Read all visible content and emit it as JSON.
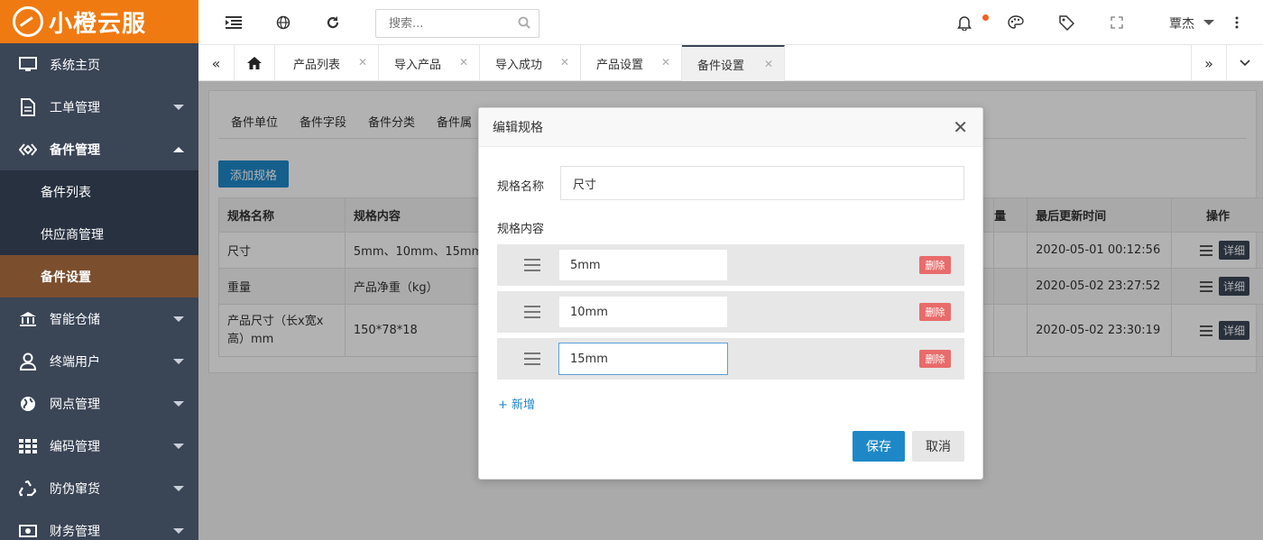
{
  "logo": {
    "text": "小橙云服"
  },
  "sidebar": {
    "items": [
      {
        "label": "系统主页",
        "icon": "monitor-icon"
      },
      {
        "label": "工单管理",
        "icon": "document-icon"
      },
      {
        "label": "备件管理",
        "icon": "diamond-icon"
      },
      {
        "label": "智能仓储",
        "icon": "bank-icon"
      },
      {
        "label": "终端用户",
        "icon": "user-icon"
      },
      {
        "label": "网点管理",
        "icon": "globe-icon"
      },
      {
        "label": "编码管理",
        "icon": "grid-icon"
      },
      {
        "label": "防伪窜货",
        "icon": "recycle-icon"
      },
      {
        "label": "财务管理",
        "icon": "money-icon"
      }
    ],
    "subitems": [
      {
        "label": "备件列表"
      },
      {
        "label": "供应商管理"
      },
      {
        "label": "备件设置"
      }
    ]
  },
  "topbar": {
    "search_placeholder": "搜索...",
    "user_name": "覃杰"
  },
  "tabs": [
    {
      "label": "产品列表"
    },
    {
      "label": "导入产品"
    },
    {
      "label": "导入成功"
    },
    {
      "label": "产品设置"
    },
    {
      "label": "备件设置"
    }
  ],
  "main": {
    "sub_tabs": [
      "备件单位",
      "备件字段",
      "备件分类",
      "备件属"
    ],
    "add_button": "添加规格",
    "table": {
      "headers": [
        "规格名称",
        "规格内容",
        "量",
        "最后更新时间",
        "操作"
      ],
      "rows": [
        {
          "name": "尺寸",
          "content": "5mm、10mm、15mm",
          "updated": "2020-05-01 00:12:56",
          "action": "详细"
        },
        {
          "name": "重量",
          "content": "产品净重（kg）",
          "updated": "2020-05-02 23:27:52",
          "action": "详细"
        },
        {
          "name": "产品尺寸（长x宽x高）mm",
          "content": "150*78*18",
          "updated": "2020-05-02 23:30:19",
          "action": "详细"
        }
      ]
    }
  },
  "modal": {
    "title": "编辑规格",
    "name_label": "规格名称",
    "name_value": "尺寸",
    "content_label": "规格内容",
    "specs": [
      {
        "value": "5mm",
        "delete": "删除"
      },
      {
        "value": "10mm",
        "delete": "删除"
      },
      {
        "value": "15mm",
        "delete": "删除"
      }
    ],
    "add_link": "+ 新增",
    "save": "保存",
    "cancel": "取消"
  },
  "colors": {
    "brand": "#f07a12",
    "sidebar": "#3a4556",
    "primary": "#1e88c7",
    "danger": "#e96b6b"
  }
}
